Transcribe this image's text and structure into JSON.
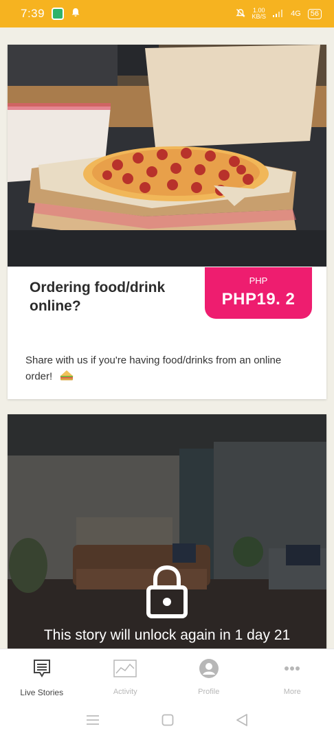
{
  "status_bar": {
    "time": "7:39",
    "net_speed_value": "1.00",
    "net_speed_unit": "KB/S",
    "network_type": "4G",
    "battery": "56"
  },
  "feed": {
    "cards": [
      {
        "title": "Ordering food/drink online?",
        "price_currency": "PHP",
        "price": "PHP19. 2",
        "description": "Share with us if you're having food/drinks from an online order!",
        "description_emoji_icon": "sandwich-icon"
      },
      {
        "locked": true,
        "lock_message": "This story will unlock again in 1 day 21"
      }
    ]
  },
  "bottom_nav": {
    "items": [
      {
        "label": "Live Stories",
        "icon": "stories-icon",
        "active": true
      },
      {
        "label": "Activity",
        "icon": "activity-chart-icon",
        "active": false
      },
      {
        "label": "Profile",
        "icon": "profile-icon",
        "active": false
      },
      {
        "label": "More",
        "icon": "more-dots-icon",
        "active": false
      }
    ]
  },
  "system_nav": {
    "icons": [
      "menu-icon",
      "home-icon",
      "back-icon"
    ]
  },
  "colors": {
    "status_bar": "#f6b320",
    "price_badge": "#ee1d6f",
    "background": "#f1efe6"
  }
}
